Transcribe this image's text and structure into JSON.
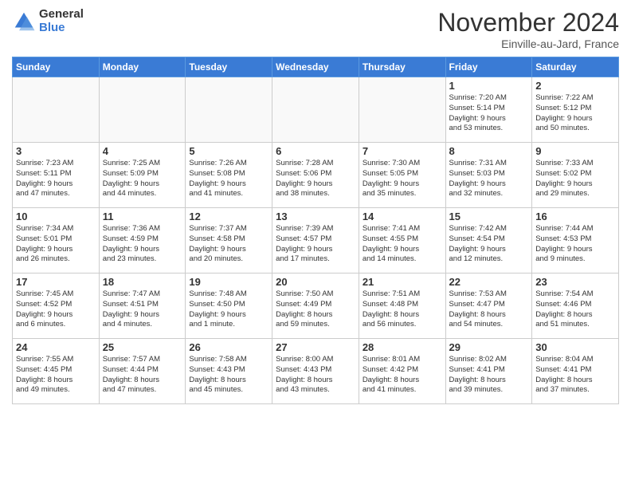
{
  "logo": {
    "general": "General",
    "blue": "Blue"
  },
  "header": {
    "month": "November 2024",
    "location": "Einville-au-Jard, France"
  },
  "weekdays": [
    "Sunday",
    "Monday",
    "Tuesday",
    "Wednesday",
    "Thursday",
    "Friday",
    "Saturday"
  ],
  "weeks": [
    [
      {
        "day": "",
        "info": ""
      },
      {
        "day": "",
        "info": ""
      },
      {
        "day": "",
        "info": ""
      },
      {
        "day": "",
        "info": ""
      },
      {
        "day": "",
        "info": ""
      },
      {
        "day": "1",
        "info": "Sunrise: 7:20 AM\nSunset: 5:14 PM\nDaylight: 9 hours\nand 53 minutes."
      },
      {
        "day": "2",
        "info": "Sunrise: 7:22 AM\nSunset: 5:12 PM\nDaylight: 9 hours\nand 50 minutes."
      }
    ],
    [
      {
        "day": "3",
        "info": "Sunrise: 7:23 AM\nSunset: 5:11 PM\nDaylight: 9 hours\nand 47 minutes."
      },
      {
        "day": "4",
        "info": "Sunrise: 7:25 AM\nSunset: 5:09 PM\nDaylight: 9 hours\nand 44 minutes."
      },
      {
        "day": "5",
        "info": "Sunrise: 7:26 AM\nSunset: 5:08 PM\nDaylight: 9 hours\nand 41 minutes."
      },
      {
        "day": "6",
        "info": "Sunrise: 7:28 AM\nSunset: 5:06 PM\nDaylight: 9 hours\nand 38 minutes."
      },
      {
        "day": "7",
        "info": "Sunrise: 7:30 AM\nSunset: 5:05 PM\nDaylight: 9 hours\nand 35 minutes."
      },
      {
        "day": "8",
        "info": "Sunrise: 7:31 AM\nSunset: 5:03 PM\nDaylight: 9 hours\nand 32 minutes."
      },
      {
        "day": "9",
        "info": "Sunrise: 7:33 AM\nSunset: 5:02 PM\nDaylight: 9 hours\nand 29 minutes."
      }
    ],
    [
      {
        "day": "10",
        "info": "Sunrise: 7:34 AM\nSunset: 5:01 PM\nDaylight: 9 hours\nand 26 minutes."
      },
      {
        "day": "11",
        "info": "Sunrise: 7:36 AM\nSunset: 4:59 PM\nDaylight: 9 hours\nand 23 minutes."
      },
      {
        "day": "12",
        "info": "Sunrise: 7:37 AM\nSunset: 4:58 PM\nDaylight: 9 hours\nand 20 minutes."
      },
      {
        "day": "13",
        "info": "Sunrise: 7:39 AM\nSunset: 4:57 PM\nDaylight: 9 hours\nand 17 minutes."
      },
      {
        "day": "14",
        "info": "Sunrise: 7:41 AM\nSunset: 4:55 PM\nDaylight: 9 hours\nand 14 minutes."
      },
      {
        "day": "15",
        "info": "Sunrise: 7:42 AM\nSunset: 4:54 PM\nDaylight: 9 hours\nand 12 minutes."
      },
      {
        "day": "16",
        "info": "Sunrise: 7:44 AM\nSunset: 4:53 PM\nDaylight: 9 hours\nand 9 minutes."
      }
    ],
    [
      {
        "day": "17",
        "info": "Sunrise: 7:45 AM\nSunset: 4:52 PM\nDaylight: 9 hours\nand 6 minutes."
      },
      {
        "day": "18",
        "info": "Sunrise: 7:47 AM\nSunset: 4:51 PM\nDaylight: 9 hours\nand 4 minutes."
      },
      {
        "day": "19",
        "info": "Sunrise: 7:48 AM\nSunset: 4:50 PM\nDaylight: 9 hours\nand 1 minute."
      },
      {
        "day": "20",
        "info": "Sunrise: 7:50 AM\nSunset: 4:49 PM\nDaylight: 8 hours\nand 59 minutes."
      },
      {
        "day": "21",
        "info": "Sunrise: 7:51 AM\nSunset: 4:48 PM\nDaylight: 8 hours\nand 56 minutes."
      },
      {
        "day": "22",
        "info": "Sunrise: 7:53 AM\nSunset: 4:47 PM\nDaylight: 8 hours\nand 54 minutes."
      },
      {
        "day": "23",
        "info": "Sunrise: 7:54 AM\nSunset: 4:46 PM\nDaylight: 8 hours\nand 51 minutes."
      }
    ],
    [
      {
        "day": "24",
        "info": "Sunrise: 7:55 AM\nSunset: 4:45 PM\nDaylight: 8 hours\nand 49 minutes."
      },
      {
        "day": "25",
        "info": "Sunrise: 7:57 AM\nSunset: 4:44 PM\nDaylight: 8 hours\nand 47 minutes."
      },
      {
        "day": "26",
        "info": "Sunrise: 7:58 AM\nSunset: 4:43 PM\nDaylight: 8 hours\nand 45 minutes."
      },
      {
        "day": "27",
        "info": "Sunrise: 8:00 AM\nSunset: 4:43 PM\nDaylight: 8 hours\nand 43 minutes."
      },
      {
        "day": "28",
        "info": "Sunrise: 8:01 AM\nSunset: 4:42 PM\nDaylight: 8 hours\nand 41 minutes."
      },
      {
        "day": "29",
        "info": "Sunrise: 8:02 AM\nSunset: 4:41 PM\nDaylight: 8 hours\nand 39 minutes."
      },
      {
        "day": "30",
        "info": "Sunrise: 8:04 AM\nSunset: 4:41 PM\nDaylight: 8 hours\nand 37 minutes."
      }
    ]
  ]
}
